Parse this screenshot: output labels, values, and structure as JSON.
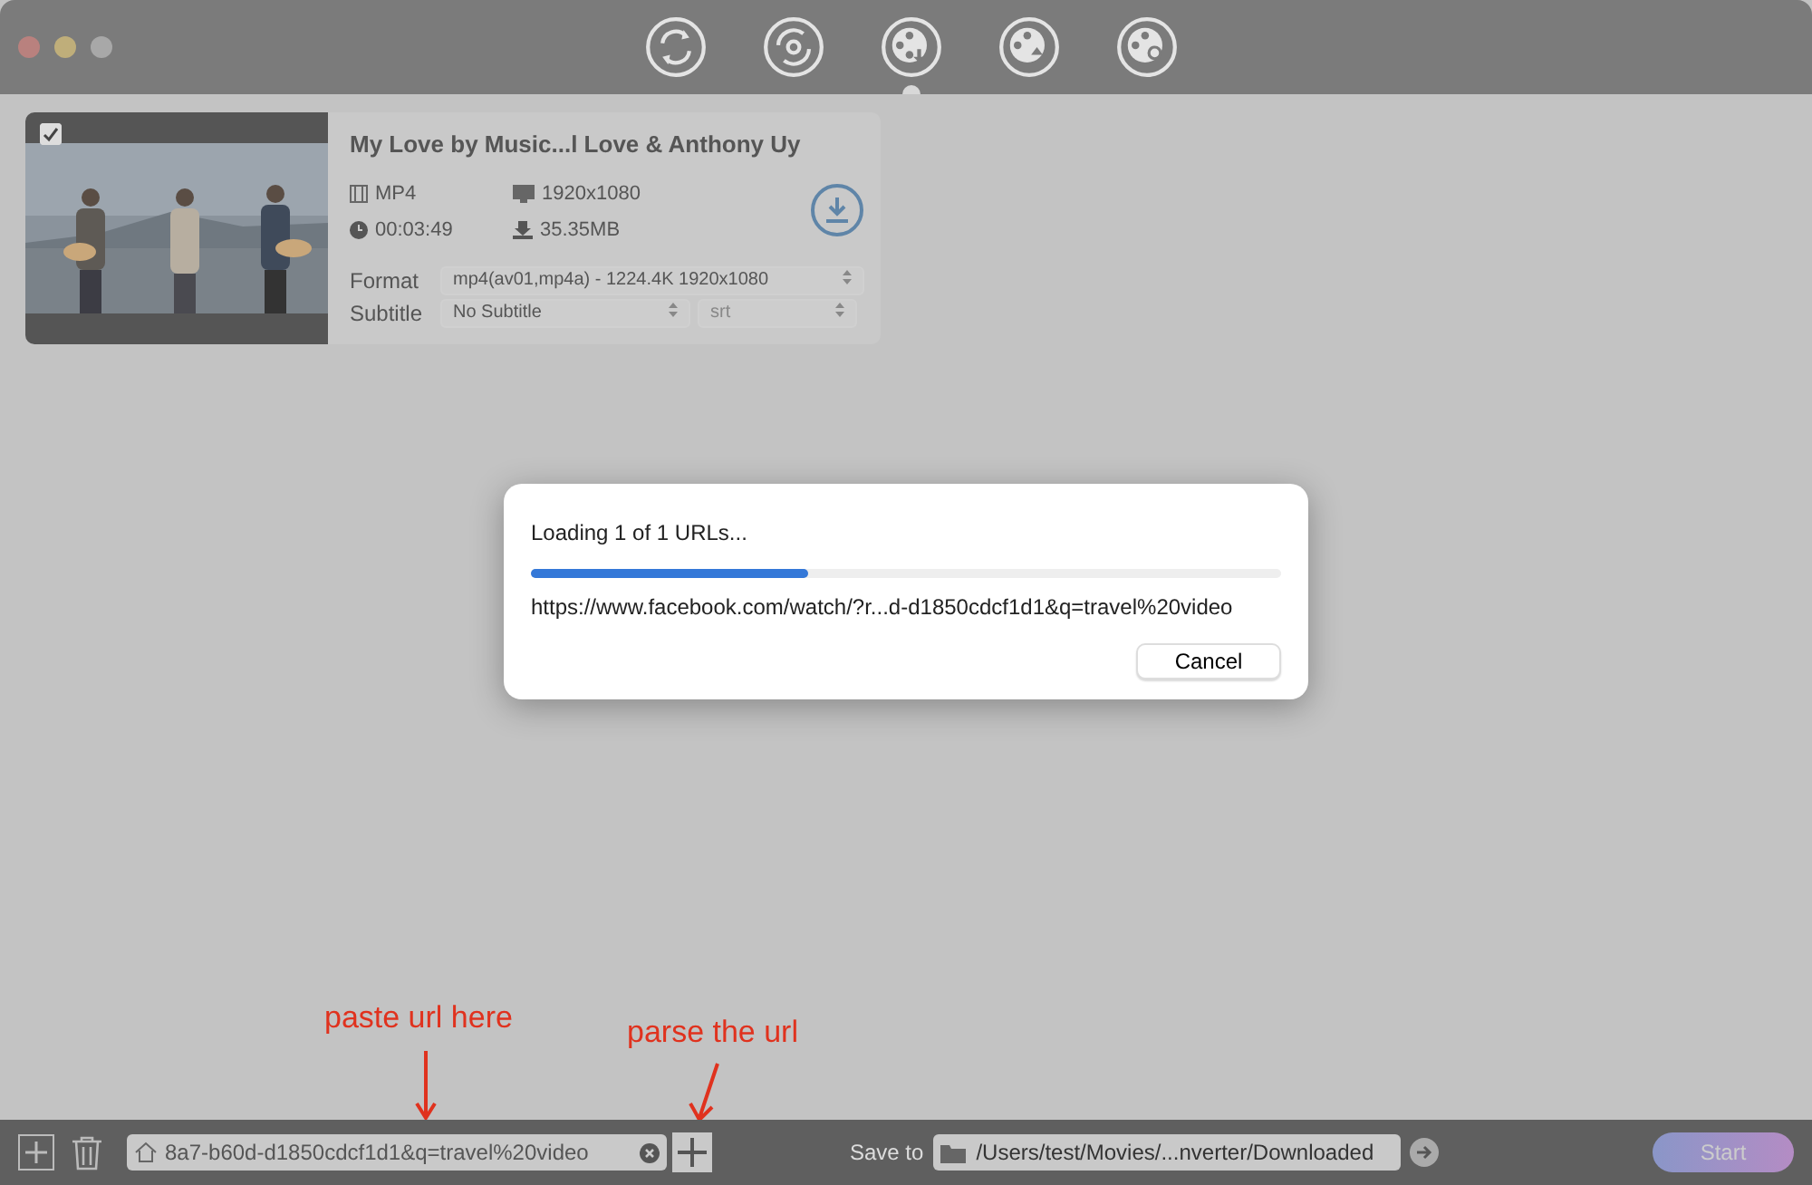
{
  "toolbar": {
    "tabs": [
      {
        "kind": "convert",
        "selected": false
      },
      {
        "kind": "record",
        "selected": false
      },
      {
        "kind": "download",
        "selected": true
      },
      {
        "kind": "edit",
        "selected": false
      },
      {
        "kind": "tools",
        "selected": false
      }
    ]
  },
  "video": {
    "checked": true,
    "title": "My Love by Music...l Love & Anthony Uy",
    "container": "MP4",
    "resolution": "1920x1080",
    "duration": "00:03:49",
    "size": "35.35MB",
    "format_label": "Format",
    "format": "mp4(av01,mp4a) - 1224.4K 1920x1080",
    "subtitle_label": "Subtitle",
    "subtitle": "No Subtitle",
    "subtitle_type": "srt"
  },
  "dialog": {
    "message": "Loading 1 of 1 URLs...",
    "level": 0.37,
    "url": "https://www.facebook.com/watch/?r...d-d1850cdcf1d1&q=travel%20video",
    "button": "Cancel"
  },
  "bottom_bar": {
    "url_field": "8a7-b60d-d1850cdcf1d1&q=travel%20video",
    "save_label": "Save to",
    "save_path": "/Users/test/Movies/...nverter/Downloaded",
    "start": "Start"
  },
  "annotations": [
    {
      "text": "paste url here"
    },
    {
      "text": "parse the url"
    }
  ]
}
